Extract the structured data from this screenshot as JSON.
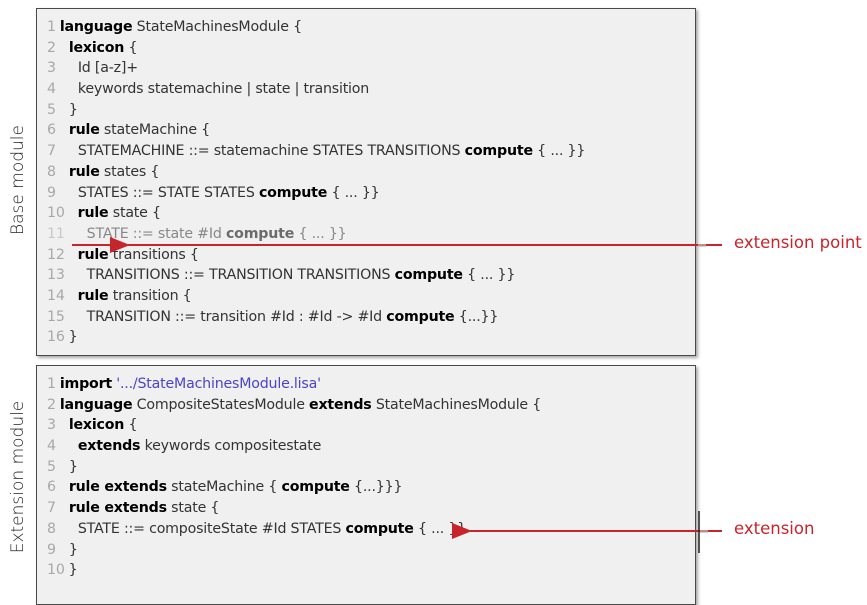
{
  "labels": {
    "base_module": "Base module",
    "extension_module": "Extension module"
  },
  "callouts": {
    "extension_point": "extension point",
    "extension": "extension"
  },
  "colors": {
    "keyword": "#000000",
    "string": "#4a44c7",
    "callout": "#c8242b",
    "panel_bg": "#f0f0f0"
  },
  "base_code": [
    {
      "n": "1",
      "indent": 0,
      "tokens": [
        {
          "t": "language",
          "c": "kw"
        },
        {
          "t": " StateMachinesModule {",
          "c": "tx"
        }
      ]
    },
    {
      "n": "2",
      "indent": 1,
      "tokens": [
        {
          "t": "lexicon",
          "c": "kw"
        },
        {
          "t": " {",
          "c": "tx"
        }
      ]
    },
    {
      "n": "3",
      "indent": 2,
      "tokens": [
        {
          "t": "Id [a-z]+",
          "c": "tx"
        }
      ]
    },
    {
      "n": "4",
      "indent": 2,
      "tokens": [
        {
          "t": "keywords statemachine | state | transition",
          "c": "tx"
        }
      ]
    },
    {
      "n": "5",
      "indent": 1,
      "tokens": [
        {
          "t": "}",
          "c": "tx"
        }
      ]
    },
    {
      "n": "6",
      "indent": 1,
      "tokens": [
        {
          "t": "rule",
          "c": "kw"
        },
        {
          "t": " stateMachine {",
          "c": "tx"
        }
      ]
    },
    {
      "n": "7",
      "indent": 2,
      "tokens": [
        {
          "t": "STATEMACHINE ::= statemachine STATES TRANSITIONS ",
          "c": "tx"
        },
        {
          "t": "compute",
          "c": "kw"
        },
        {
          "t": " { ... }}",
          "c": "tx"
        }
      ]
    },
    {
      "n": "8",
      "indent": 1,
      "tokens": [
        {
          "t": "rule",
          "c": "kw"
        },
        {
          "t": " states {",
          "c": "tx"
        }
      ]
    },
    {
      "n": "9",
      "indent": 2,
      "tokens": [
        {
          "t": "STATES ::= STATE STATES ",
          "c": "tx"
        },
        {
          "t": "compute",
          "c": "kw"
        },
        {
          "t": " { ... }}",
          "c": "tx"
        }
      ]
    },
    {
      "n": "10",
      "indent": 1,
      "tokens": [
        {
          "t": "rule",
          "c": "kw"
        },
        {
          "t": " state {",
          "c": "tx"
        }
      ]
    },
    {
      "n": "11",
      "indent": 2,
      "tokens": [
        {
          "t": "STATE ::= state #Id ",
          "c": "tx"
        },
        {
          "t": "compute",
          "c": "kw"
        },
        {
          "t": " { ... }}",
          "c": "tx"
        }
      ]
    },
    {
      "n": "12",
      "indent": 1,
      "tokens": [
        {
          "t": "rule",
          "c": "kw"
        },
        {
          "t": " transitions {",
          "c": "tx"
        }
      ]
    },
    {
      "n": "13",
      "indent": 2,
      "tokens": [
        {
          "t": "TRANSITIONS ::= TRANSITION TRANSITIONS ",
          "c": "tx"
        },
        {
          "t": "compute",
          "c": "kw"
        },
        {
          "t": " { ... }}",
          "c": "tx"
        }
      ]
    },
    {
      "n": "14",
      "indent": 1,
      "tokens": [
        {
          "t": "rule",
          "c": "kw"
        },
        {
          "t": " transition {",
          "c": "tx"
        }
      ]
    },
    {
      "n": "15",
      "indent": 2,
      "tokens": [
        {
          "t": "TRANSITION ::= transition #Id : #Id -> #Id ",
          "c": "tx"
        },
        {
          "t": "compute",
          "c": "kw"
        },
        {
          "t": " {...}}",
          "c": "tx"
        }
      ]
    },
    {
      "n": "16",
      "indent": 0,
      "tokens": [
        {
          "t": "}",
          "c": "tx"
        }
      ]
    }
  ],
  "ext_code": [
    {
      "n": "1",
      "indent": 0,
      "tokens": [
        {
          "t": "import",
          "c": "kw"
        },
        {
          "t": " '.../StateMachinesModule.lisa'",
          "c": "str"
        }
      ]
    },
    {
      "n": "2",
      "indent": 0,
      "tokens": [
        {
          "t": "language",
          "c": "kw"
        },
        {
          "t": " CompositeStatesModule ",
          "c": "tx"
        },
        {
          "t": "extends",
          "c": "kw"
        },
        {
          "t": " StateMachinesModule {",
          "c": "tx"
        }
      ]
    },
    {
      "n": "3",
      "indent": 1,
      "tokens": [
        {
          "t": "lexicon",
          "c": "kw"
        },
        {
          "t": " {",
          "c": "tx"
        }
      ]
    },
    {
      "n": "4",
      "indent": 2,
      "tokens": [
        {
          "t": "extends",
          "c": "kw"
        },
        {
          "t": " keywords compositestate",
          "c": "tx"
        }
      ]
    },
    {
      "n": "5",
      "indent": 1,
      "tokens": [
        {
          "t": "}",
          "c": "tx"
        }
      ]
    },
    {
      "n": "6",
      "indent": 1,
      "tokens": [
        {
          "t": "rule extends",
          "c": "kw"
        },
        {
          "t": " stateMachine { ",
          "c": "tx"
        },
        {
          "t": "compute",
          "c": "kw"
        },
        {
          "t": " {...}}}",
          "c": "tx"
        }
      ]
    },
    {
      "n": "7",
      "indent": 1,
      "tokens": [
        {
          "t": "rule extends",
          "c": "kw"
        },
        {
          "t": " state {",
          "c": "tx"
        }
      ]
    },
    {
      "n": "8",
      "indent": 2,
      "tokens": [
        {
          "t": "STATE ::= compositeState #Id STATES ",
          "c": "tx"
        },
        {
          "t": "compute",
          "c": "kw"
        },
        {
          "t": " { ... }}",
          "c": "tx"
        }
      ]
    },
    {
      "n": "9",
      "indent": 1,
      "tokens": [
        {
          "t": "}",
          "c": "tx"
        }
      ]
    },
    {
      "n": "10",
      "indent": 0,
      "tokens": [
        {
          "t": "}",
          "c": "tx"
        }
      ]
    }
  ]
}
